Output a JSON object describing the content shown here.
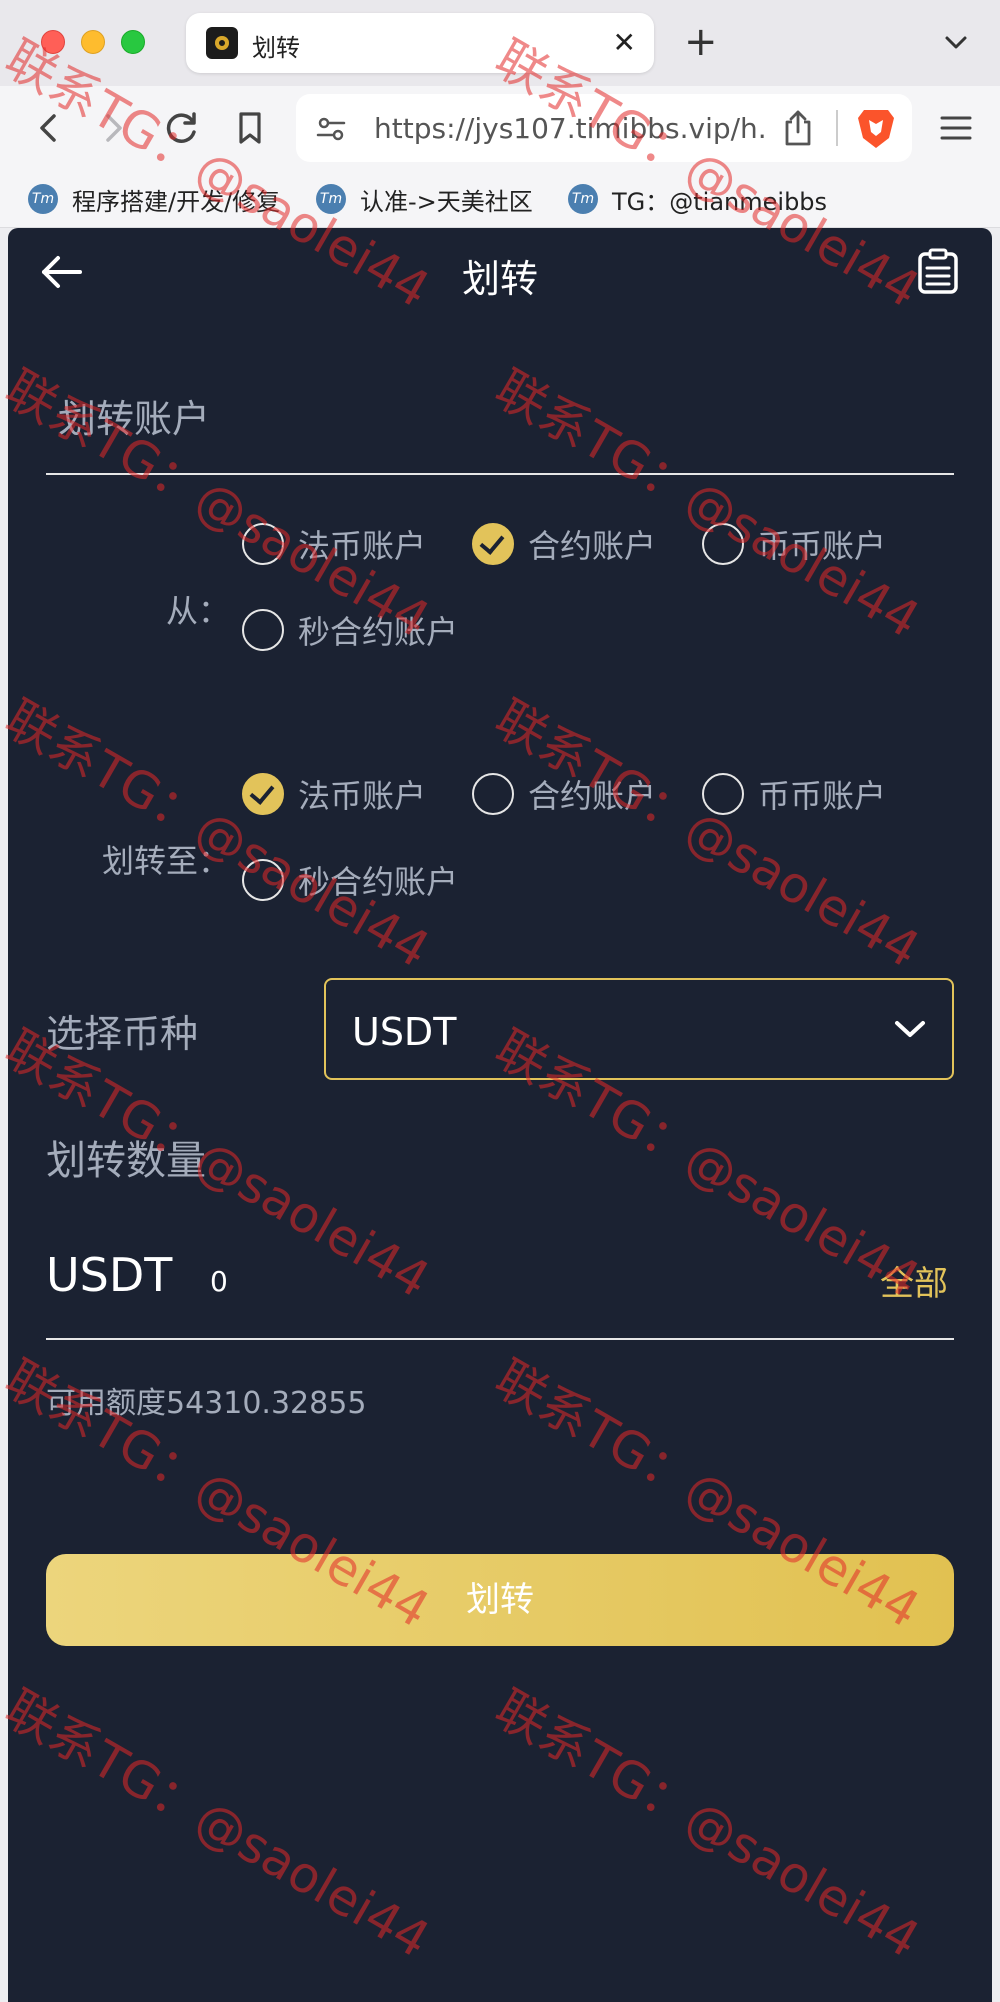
{
  "browser": {
    "tab_title": "划转",
    "tab_close": "✕",
    "new_tab": "+",
    "url": "https://jys107.timibbs.vip/h...",
    "bookmarks": [
      {
        "icon": "Tm",
        "label": "程序搭建/开发/修复"
      },
      {
        "icon": "Tm",
        "label": "认准->天美社区"
      },
      {
        "icon": "Tm",
        "label": "TG：@tianmeibbs"
      }
    ]
  },
  "page": {
    "title": "划转",
    "section_title": "划转账户",
    "from": {
      "label": "从：",
      "options": [
        "法币账户",
        "合约账户",
        "币币账户",
        "秒合约账户"
      ],
      "selected": "合约账户"
    },
    "to": {
      "label": "划转至：",
      "options": [
        "法币账户",
        "合约账户",
        "币币账户",
        "秒合约账户"
      ],
      "selected": "法币账户"
    },
    "coin": {
      "label": "选择币种",
      "value": "USDT"
    },
    "amount": {
      "label": "划转数量",
      "unit": "USDT",
      "value": "0",
      "all_label": "全部",
      "available": "可用额度54310.32855"
    },
    "submit_label": "划转"
  },
  "watermark": "联系TG：@saolei44",
  "colors": {
    "page_bg": "#1b2232",
    "accent": "#e2c35a",
    "label_gray": "#a4acbb",
    "watermark": "#e12828"
  }
}
